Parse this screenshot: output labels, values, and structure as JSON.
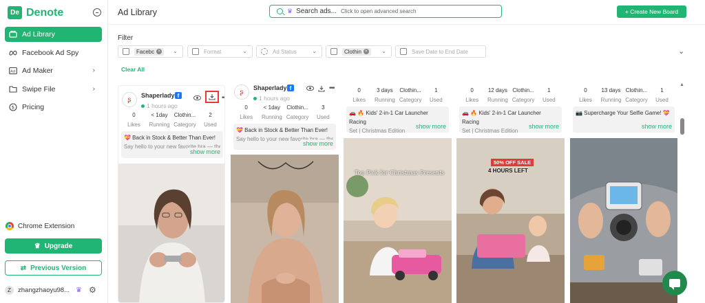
{
  "app": {
    "logo_mark": "De",
    "name": "Denote"
  },
  "sidebar": {
    "items": [
      {
        "label": "Ad Library",
        "icon": "library-icon"
      },
      {
        "label": "Facebook Ad Spy",
        "icon": "meta-icon"
      },
      {
        "label": "Ad Maker",
        "icon": "ad-maker-icon"
      },
      {
        "label": "Swipe File",
        "icon": "folder-icon"
      },
      {
        "label": "Pricing",
        "icon": "dollar-icon"
      }
    ],
    "chrome_extension": "Chrome Extension",
    "upgrade": "Upgrade",
    "previous_version": "Previous Version",
    "user": {
      "avatar_letter": "Z",
      "name": "zhangzhaoyu98..."
    }
  },
  "header": {
    "title": "Ad Library",
    "search_label": "Search ads...",
    "search_hint": "Click to open advanced search",
    "create_board": "+ Create New Board"
  },
  "filters": {
    "title": "Filter",
    "platform": {
      "value": "Facebc"
    },
    "format": {
      "placeholder": "Format"
    },
    "status": {
      "placeholder": "Ad Status"
    },
    "category": {
      "value": "Clothin"
    },
    "date": {
      "placeholder": "Save Date to End Date"
    },
    "clear_all": "Clear All"
  },
  "cards": [
    {
      "brand": "Shaperlady",
      "time": "1 hours ago",
      "stats": [
        {
          "v": "0",
          "l": "Likes"
        },
        {
          "v": "< 1day",
          "l": "Running"
        },
        {
          "v": "Clothin...",
          "l": "Category"
        },
        {
          "v": "2",
          "l": "Used"
        }
      ],
      "text": "💝 Back in Stock & Better Than Ever!",
      "sub": "Say hello to your new favorite bra — the",
      "show_more": "show more"
    },
    {
      "brand": "Shaperlady",
      "time": "1 hours ago",
      "stats": [
        {
          "v": "0",
          "l": "Likes"
        },
        {
          "v": "< 1day",
          "l": "Running"
        },
        {
          "v": "Clothin...",
          "l": "Category"
        },
        {
          "v": "3",
          "l": "Used"
        }
      ],
      "text": "💝 Back in Stock & Better Than Ever!",
      "sub": "Say hello to your new favorite bra — the",
      "show_more": "show more"
    },
    {
      "stats": [
        {
          "v": "0",
          "l": "Likes"
        },
        {
          "v": "3 days",
          "l": "Running"
        },
        {
          "v": "Clothin...",
          "l": "Category"
        },
        {
          "v": "1",
          "l": "Used"
        }
      ],
      "text": "🚗 🔥 Kids' 2-in-1 Car Launcher Racing",
      "sub": "Set | Christmas Edition",
      "show_more": "show more",
      "image_text": "Top Pick for Christmas Presents"
    },
    {
      "stats": [
        {
          "v": "0",
          "l": "Likes"
        },
        {
          "v": "12 days",
          "l": "Running"
        },
        {
          "v": "Clothin...",
          "l": "Category"
        },
        {
          "v": "1",
          "l": "Used"
        }
      ],
      "text": "🚗 🔥 Kids' 2-in-1 Car Launcher Racing",
      "sub": "Set | Christmas Edition",
      "show_more": "show more",
      "image_text": "50% OFF SALE",
      "image_text2": "4 HOURS LEFT"
    },
    {
      "stats": [
        {
          "v": "0",
          "l": "Likes"
        },
        {
          "v": "13 days",
          "l": "Running"
        },
        {
          "v": "Clothin...",
          "l": "Category"
        },
        {
          "v": "1",
          "l": "Used"
        }
      ],
      "text": "📷 Supercharge Your Selfie Game! 💝",
      "show_more": "show more"
    }
  ],
  "colors": {
    "accent": "#21b573",
    "highlight": "#e53935",
    "crown": "#8b5cf6",
    "facebook": "#1877f2"
  }
}
